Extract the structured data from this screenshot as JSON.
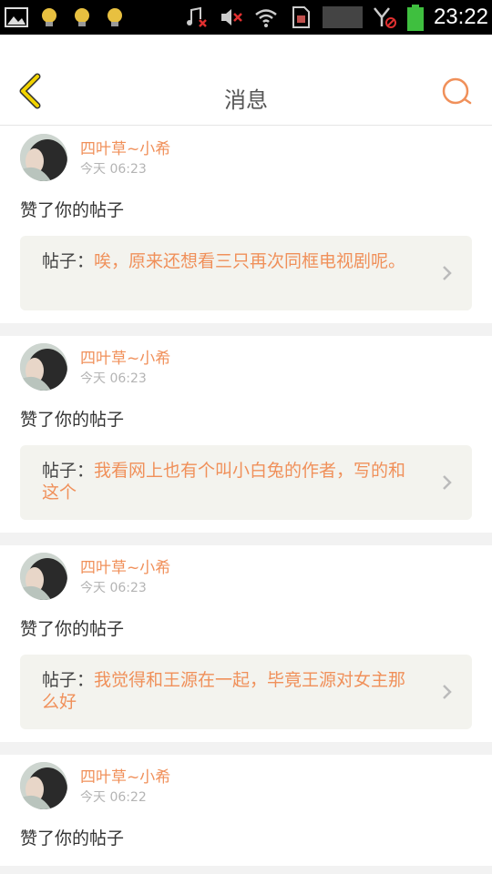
{
  "status_bar": {
    "time": "23:22",
    "left_icons": [
      "gallery-icon",
      "notification-lightbulb-icon",
      "notification-lightbulb-icon",
      "notification-lightbulb-icon"
    ],
    "right_icons": [
      "music-muted-icon",
      "volume-muted-icon",
      "wifi-icon",
      "sim-card-icon",
      "signal-icon",
      "no-signal-icon",
      "battery-icon"
    ],
    "battery_color": "#3fbf3f"
  },
  "header": {
    "title": "消息",
    "back_icon": "back-arrow-icon",
    "search_icon": "search-icon",
    "accent_color": "#f0905a",
    "back_color": "#e6c200"
  },
  "messages": [
    {
      "username": "四叶草~小希",
      "time": "今天 06:23",
      "action": "赞了你的帖子",
      "post_prefix": "帖子：",
      "post_text": "唉，原来还想看三只再次同框电视剧呢。"
    },
    {
      "username": "四叶草~小希",
      "time": "今天 06:23",
      "action": "赞了你的帖子",
      "post_prefix": "帖子：",
      "post_text": "我看网上也有个叫小白兔的作者，写的和这个"
    },
    {
      "username": "四叶草~小希",
      "time": "今天 06:23",
      "action": "赞了你的帖子",
      "post_prefix": "帖子：",
      "post_text": "我觉得和王源在一起，毕竟王源对女主那么好"
    },
    {
      "username": "四叶草~小希",
      "time": "今天 06:22",
      "action": "赞了你的帖子",
      "post_prefix": "帖子：",
      "post_text": ""
    }
  ]
}
